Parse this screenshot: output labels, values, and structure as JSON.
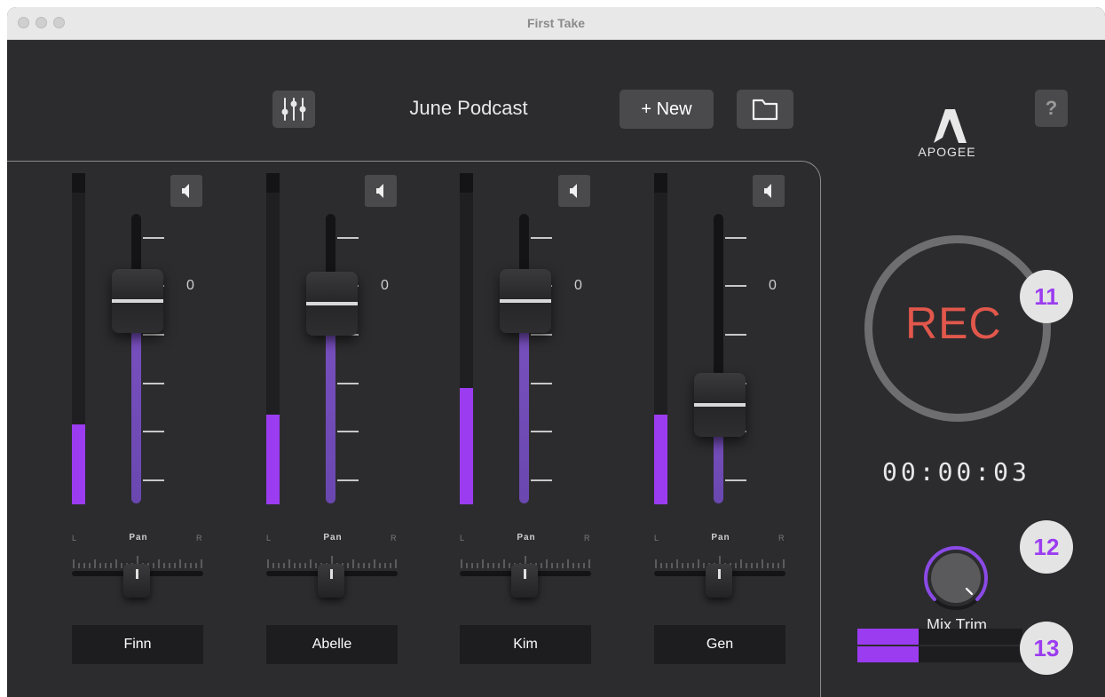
{
  "window": {
    "title": "First Take"
  },
  "toolbar": {
    "project_name": "June Podcast",
    "new_label": "+ New",
    "help_label": "?"
  },
  "logo": {
    "text": "APOGEE"
  },
  "channels": [
    {
      "name": "Finn",
      "pan_label": "Pan",
      "pan_left": "L",
      "pan_right": "R",
      "zero_label": "0",
      "meter_level": 0.24,
      "fader_level": 0.7
    },
    {
      "name": "Abelle",
      "pan_label": "Pan",
      "pan_left": "L",
      "pan_right": "R",
      "zero_label": "0",
      "meter_level": 0.27,
      "fader_level": 0.69
    },
    {
      "name": "Kim",
      "pan_label": "Pan",
      "pan_left": "L",
      "pan_right": "R",
      "zero_label": "0",
      "meter_level": 0.35,
      "fader_level": 0.7
    },
    {
      "name": "Gen",
      "pan_label": "Pan",
      "pan_left": "L",
      "pan_right": "R",
      "zero_label": "0",
      "meter_level": 0.27,
      "fader_level": 0.34
    }
  ],
  "recorder": {
    "rec_label": "REC",
    "timer": "00:00:03",
    "mix_trim_label": "Mix Trim"
  },
  "master_meter": {
    "left_level": 0.37,
    "right_level": 0.37
  },
  "callouts": {
    "rec": "11",
    "trim": "12",
    "meter": "13"
  },
  "colors": {
    "accent": "#9b3cf0",
    "rec": "#e2574c",
    "background": "#2c2c2e"
  }
}
